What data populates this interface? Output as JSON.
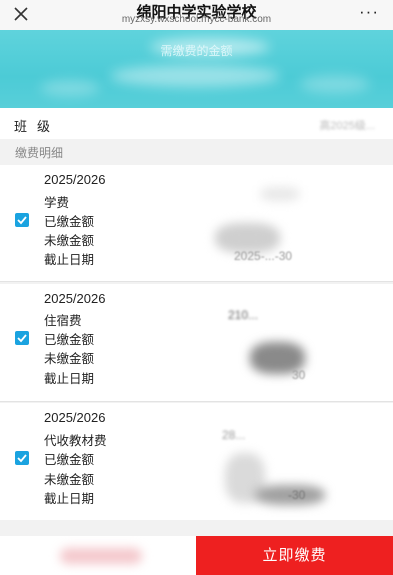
{
  "header": {
    "title": "绵阳中学实验学校",
    "subtitle": "myzxsy.wxschool.mycc-bank.com",
    "more_label": "···"
  },
  "banner": {
    "text": "需缴费的金额"
  },
  "class_row": {
    "label": "班级",
    "value": "高2025级..."
  },
  "section": {
    "label": "缴费明细"
  },
  "items": [
    {
      "year": "2025/2026",
      "fee_name": "学费",
      "paid_label": "已缴金额",
      "unpaid_label": "未缴金额",
      "deadline_label": "截止日期",
      "deadline_value": "2025-...-30",
      "checked": true
    },
    {
      "year": "2025/2026",
      "fee_name": "住宿费",
      "paid_label": "已缴金额",
      "unpaid_label": "未缴金额",
      "deadline_label": "截止日期",
      "amount_value": "210...",
      "deadline_value": "30",
      "checked": true
    },
    {
      "year": "2025/2026",
      "fee_name": "代收教材费",
      "paid_label": "已缴金额",
      "unpaid_label": "未缴金额",
      "deadline_label": "截止日期",
      "amount_value": "28...",
      "deadline_value": "-30",
      "checked": true
    }
  ],
  "footer": {
    "pay_button": "立即缴费"
  },
  "colors": {
    "accent": "#1aa3e0",
    "banner": "#4ccbd6",
    "pay": "#ee2020"
  }
}
